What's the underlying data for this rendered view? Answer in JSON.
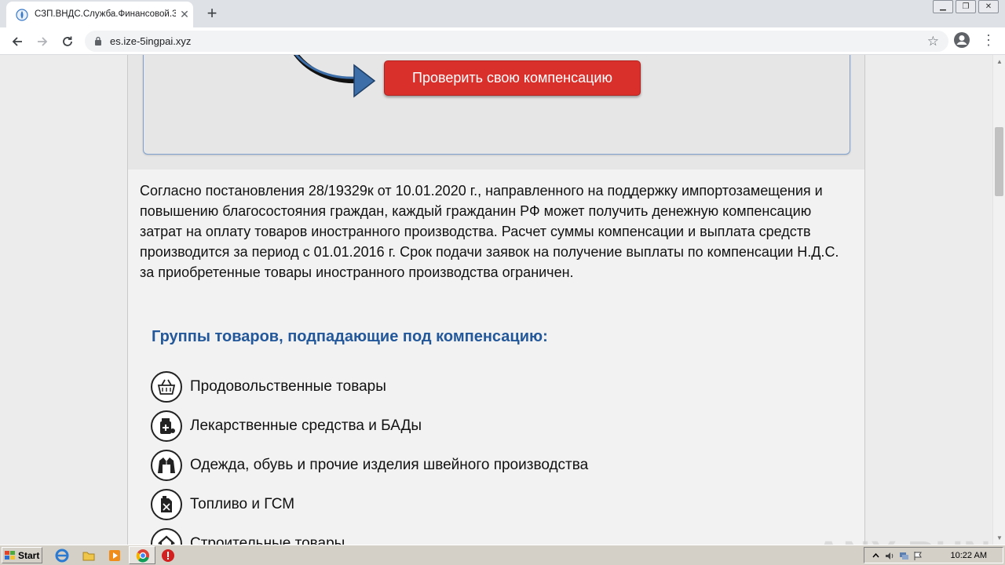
{
  "browser": {
    "tab_title": "СЗП.ВНДС.Служба.Финансовой.За",
    "url": "es.ize-5ingpai.xyz"
  },
  "form": {
    "button_label": "Проверить свою компенсацию"
  },
  "content": {
    "intro_text": "Согласно постановления 28/19329к от 10.01.2020 г., направленного на поддержку импортозамещения и повышению благосостояния граждан, каждый гражданин РФ может получить денежную компенсацию затрат на оплату товаров иностранного производства. Расчет суммы компенсации и выплата средств производится за период с 01.01.2016 г. Срок подачи заявок на получение выплаты по компенсации Н.Д.С. за приобретенные товары иностранного производства ограничен.",
    "groups_heading": "Группы товаров, подпадающие под компенсацию:",
    "groups": [
      {
        "label": "Продовольственные товары",
        "icon": "basket-icon"
      },
      {
        "label": "Лекарственные средства и БАДы",
        "icon": "medicine-icon"
      },
      {
        "label": "Одежда, обувь и прочие изделия швейного производства",
        "icon": "jacket-icon"
      },
      {
        "label": "Топливо и ГСМ",
        "icon": "fuel-can-icon"
      },
      {
        "label": "Строительные товары",
        "icon": "house-icon"
      }
    ]
  },
  "watermark": "ANY RUN",
  "taskbar": {
    "start_label": "Start",
    "clock": "10:22 AM"
  }
}
